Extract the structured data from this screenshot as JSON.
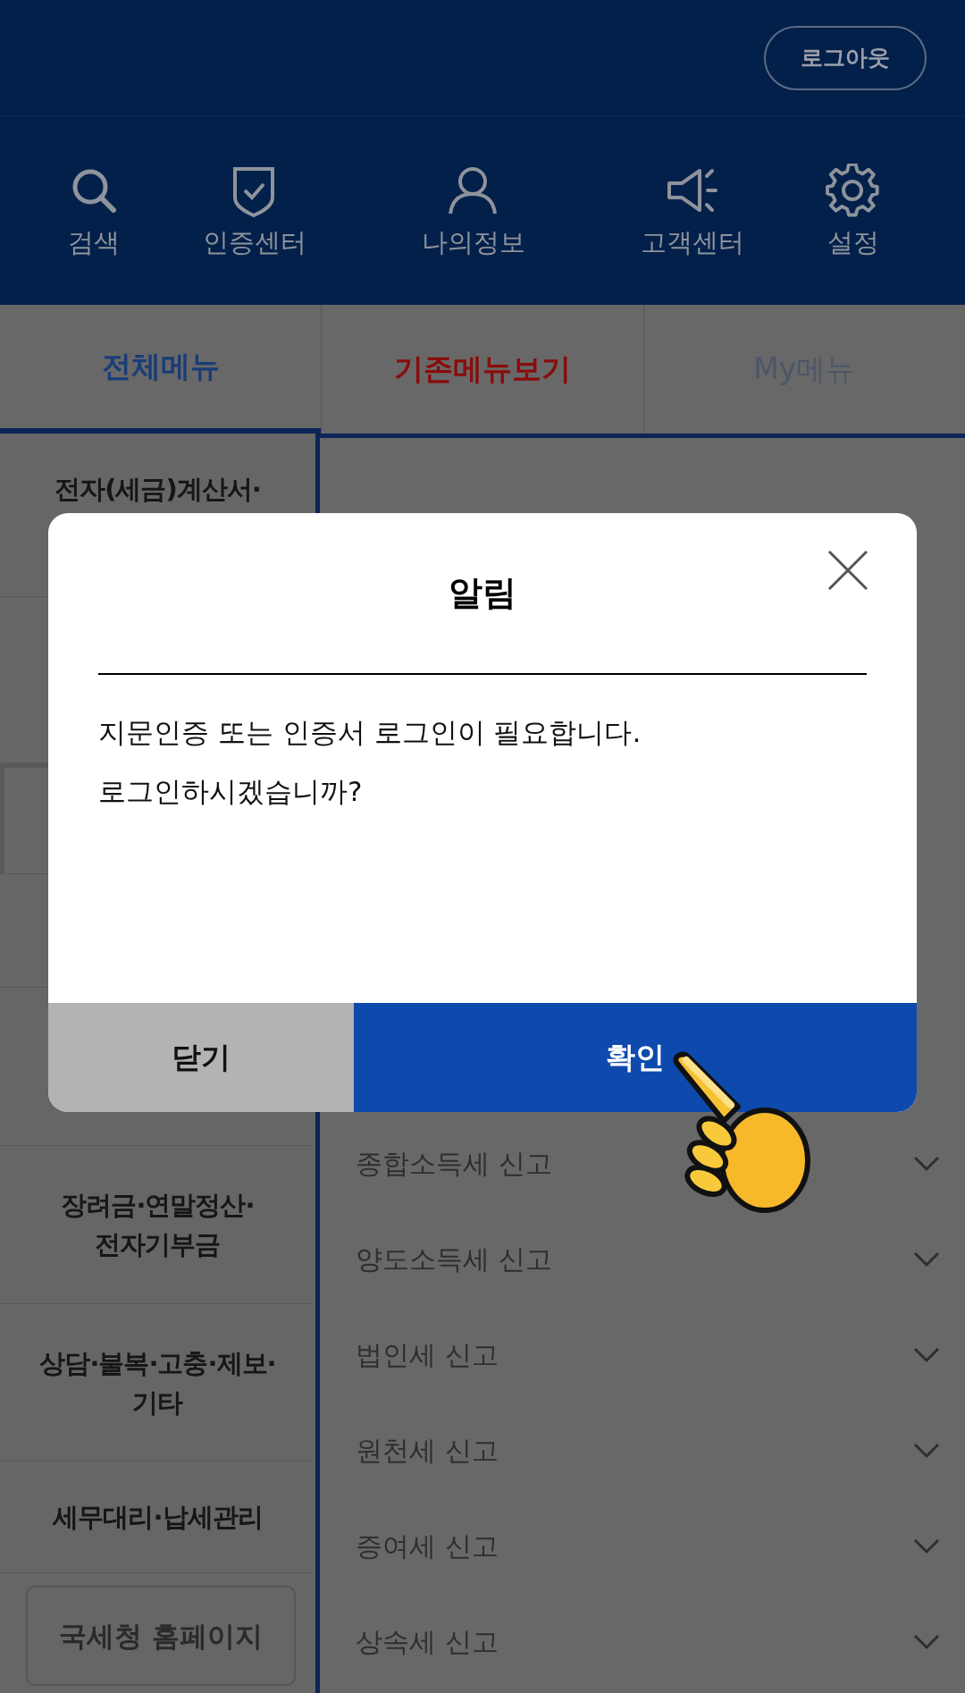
{
  "header": {
    "logout_button": "로그아웃"
  },
  "quick_menu": [
    {
      "label": "검색",
      "kind": "search"
    },
    {
      "label": "인증센터",
      "kind": "shield"
    },
    {
      "label": "나의정보",
      "kind": "person"
    },
    {
      "label": "고객센터",
      "kind": "megaphone"
    },
    {
      "label": "설정",
      "kind": "gear"
    }
  ],
  "tabs": [
    {
      "label": "전체메뉴",
      "selected": true,
      "emphasized": false
    },
    {
      "label": "기존메뉴보기",
      "selected": false,
      "emphasized": true
    },
    {
      "label": "My메뉴",
      "selected": false,
      "emphasized": false
    }
  ],
  "categories": [
    {
      "label": "전자(세금)계산서·",
      "selected": false
    },
    {
      "selected": false
    },
    {
      "selected": true
    },
    {
      "selected": false
    },
    {
      "selected": false
    },
    {
      "label": "장려금·연말정산·\n전자기부금",
      "selected": false
    },
    {
      "label": "상담·불복·고충·제보·\n기타",
      "selected": false
    },
    {
      "label": "세무대리·납세관리",
      "selected": false
    }
  ],
  "home_button": "국세청 홈페이지",
  "menu_items": [
    {
      "label": "종합소득세 신고",
      "expanded": false
    },
    {
      "label": "양도소득세 신고",
      "expanded": false
    },
    {
      "label": "법인세 신고",
      "expanded": false
    },
    {
      "label": "원천세 신고",
      "expanded": false
    },
    {
      "label": "증여세 신고",
      "expanded": false
    },
    {
      "label": "상속세 신고",
      "expanded": false
    }
  ],
  "dialog": {
    "title": "알림",
    "message": [
      "지문인증 또는 인증서 로그인이 필요합니다.",
      "로그인하시겠습니까?"
    ],
    "buttons": [
      {
        "label": "닫기",
        "kind": "secondary"
      },
      {
        "label": "확인",
        "kind": "primary"
      }
    ]
  }
}
